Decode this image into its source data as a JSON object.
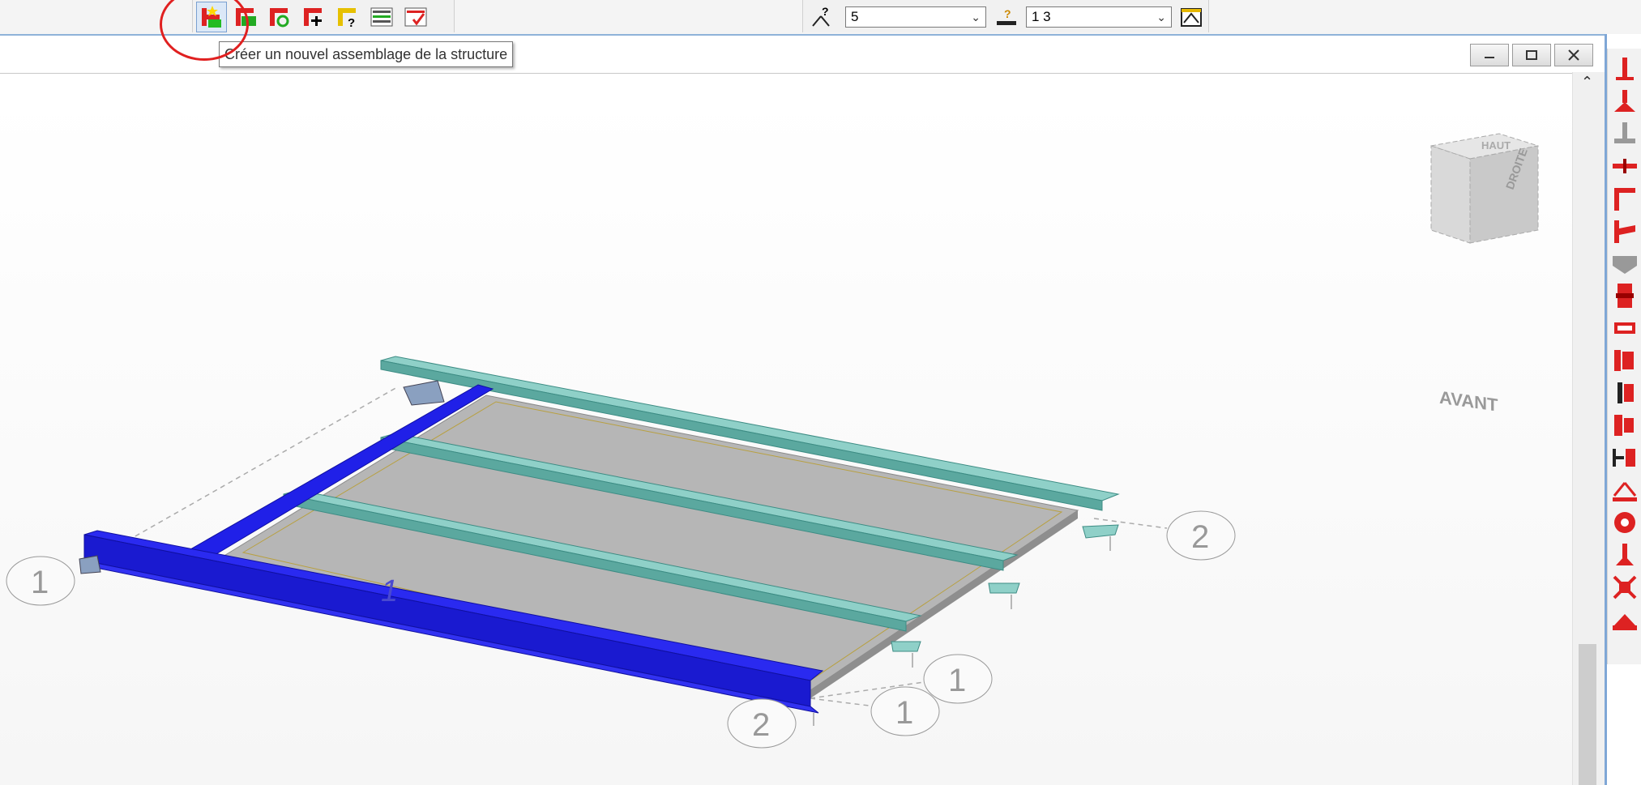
{
  "toolbar": {
    "assembly_buttons": [
      {
        "icon": "new-assembly-icon",
        "pressed": true
      },
      {
        "icon": "assembly-green-flag-icon",
        "pressed": false
      },
      {
        "icon": "assembly-refresh-icon",
        "pressed": false
      },
      {
        "icon": "assembly-add-icon",
        "pressed": false
      },
      {
        "icon": "assembly-query-icon",
        "pressed": false
      },
      {
        "icon": "assembly-list-icon",
        "pressed": false
      },
      {
        "icon": "assembly-check-icon",
        "pressed": false
      }
    ],
    "node_combo_value": "5",
    "bar_combo_value": "1 3"
  },
  "tooltip": "Créer un nouvel assemblage de la structure",
  "view_cube": {
    "front": "AVANT",
    "right": "DROITE",
    "top": "HAUT"
  },
  "viewport": {
    "member_label": "1",
    "node_labels": {
      "left_1": "1",
      "right_2": "2",
      "bottom_1a": "1",
      "bottom_1b": "1",
      "bottom_2": "2"
    }
  },
  "colors": {
    "selected_beam": "#1a1ae0",
    "beam": "#6fb8b0",
    "slab": "#b4b4b4",
    "annotation": "#e02020"
  }
}
